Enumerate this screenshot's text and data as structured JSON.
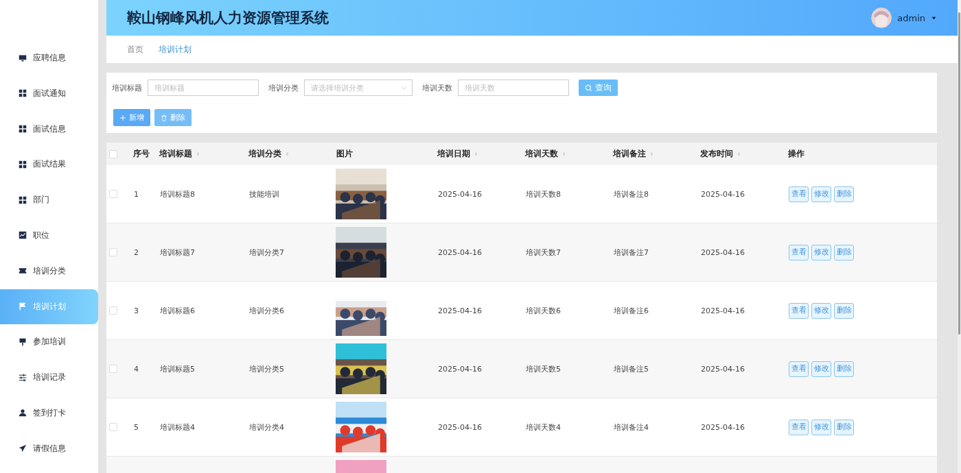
{
  "sidebar": {
    "items": [
      {
        "label": "应聘信息",
        "selected": false
      },
      {
        "label": "面试通知",
        "selected": false
      },
      {
        "label": "面试信息",
        "selected": false
      },
      {
        "label": "面试结果",
        "selected": false
      },
      {
        "label": "部门",
        "selected": false
      },
      {
        "label": "职位",
        "selected": false
      },
      {
        "label": "培训分类",
        "selected": false
      },
      {
        "label": "培训计划",
        "selected": true
      },
      {
        "label": "参加培训",
        "selected": false
      },
      {
        "label": "培训记录",
        "selected": false
      },
      {
        "label": "签到打卡",
        "selected": false
      },
      {
        "label": "请假信息",
        "selected": false
      }
    ]
  },
  "header": {
    "title": "鞍山钢峰风机人力资源管理系统",
    "user": "admin"
  },
  "breadcrumb": [
    {
      "label": "首页",
      "selected": false
    },
    {
      "label": "培训计划",
      "selected": true
    }
  ],
  "search": {
    "fields": [
      {
        "kind": "text",
        "label": "培训标题",
        "placeholder": "培训标题"
      },
      {
        "kind": "select",
        "label": "培训分类",
        "placeholder": "请选择培训分类"
      },
      {
        "kind": "text",
        "label": "培训天数",
        "placeholder": "培训天数"
      }
    ],
    "button": "查询"
  },
  "actions": [
    {
      "kind": "add",
      "label": "新增"
    },
    {
      "kind": "delete",
      "label": "删除"
    }
  ],
  "table": {
    "all_checked": false,
    "columns": [
      {
        "label": "序号",
        "sortable": false
      },
      {
        "label": "培训标题",
        "sortable": true
      },
      {
        "label": "培训分类",
        "sortable": true
      },
      {
        "label": "图片",
        "sortable": false
      },
      {
        "label": "培训日期",
        "sortable": true
      },
      {
        "label": "培训天数",
        "sortable": true
      },
      {
        "label": "培训备注",
        "sortable": true
      },
      {
        "label": "发布时间",
        "sortable": true
      },
      {
        "label": "操作",
        "sortable": false
      }
    ],
    "rows": [
      {
        "checked": false,
        "cells": [
          "1",
          "培训标题8",
          "技能培训",
          "",
          "2025-04-16",
          "培训天数8",
          "培训备注8",
          "2025-04-16"
        ],
        "buttons": [
          "查看",
          "修改",
          "删除"
        ]
      },
      {
        "checked": false,
        "cells": [
          "2",
          "培训标题7",
          "培训分类7",
          "",
          "2025-04-16",
          "培训天数7",
          "培训备注7",
          "2025-04-16"
        ],
        "buttons": [
          "查看",
          "修改",
          "删除"
        ]
      },
      {
        "checked": false,
        "cells": [
          "3",
          "培训标题6",
          "培训分类6",
          "",
          "2025-04-16",
          "培训天数6",
          "培训备注6",
          "2025-04-16"
        ],
        "buttons": [
          "查看",
          "修改",
          "删除"
        ]
      },
      {
        "checked": false,
        "cells": [
          "4",
          "培训标题5",
          "培训分类5",
          "",
          "2025-04-16",
          "培训天数5",
          "培训备注5",
          "2025-04-16"
        ],
        "buttons": [
          "查看",
          "修改",
          "删除"
        ]
      },
      {
        "checked": false,
        "cells": [
          "5",
          "培训标题4",
          "培训分类4",
          "",
          "2025-04-16",
          "培训天数4",
          "培训备注4",
          "2025-04-16"
        ],
        "buttons": [
          "查看",
          "修改",
          "删除"
        ]
      },
      {
        "cells": [],
        "buttons": []
      }
    ]
  }
}
